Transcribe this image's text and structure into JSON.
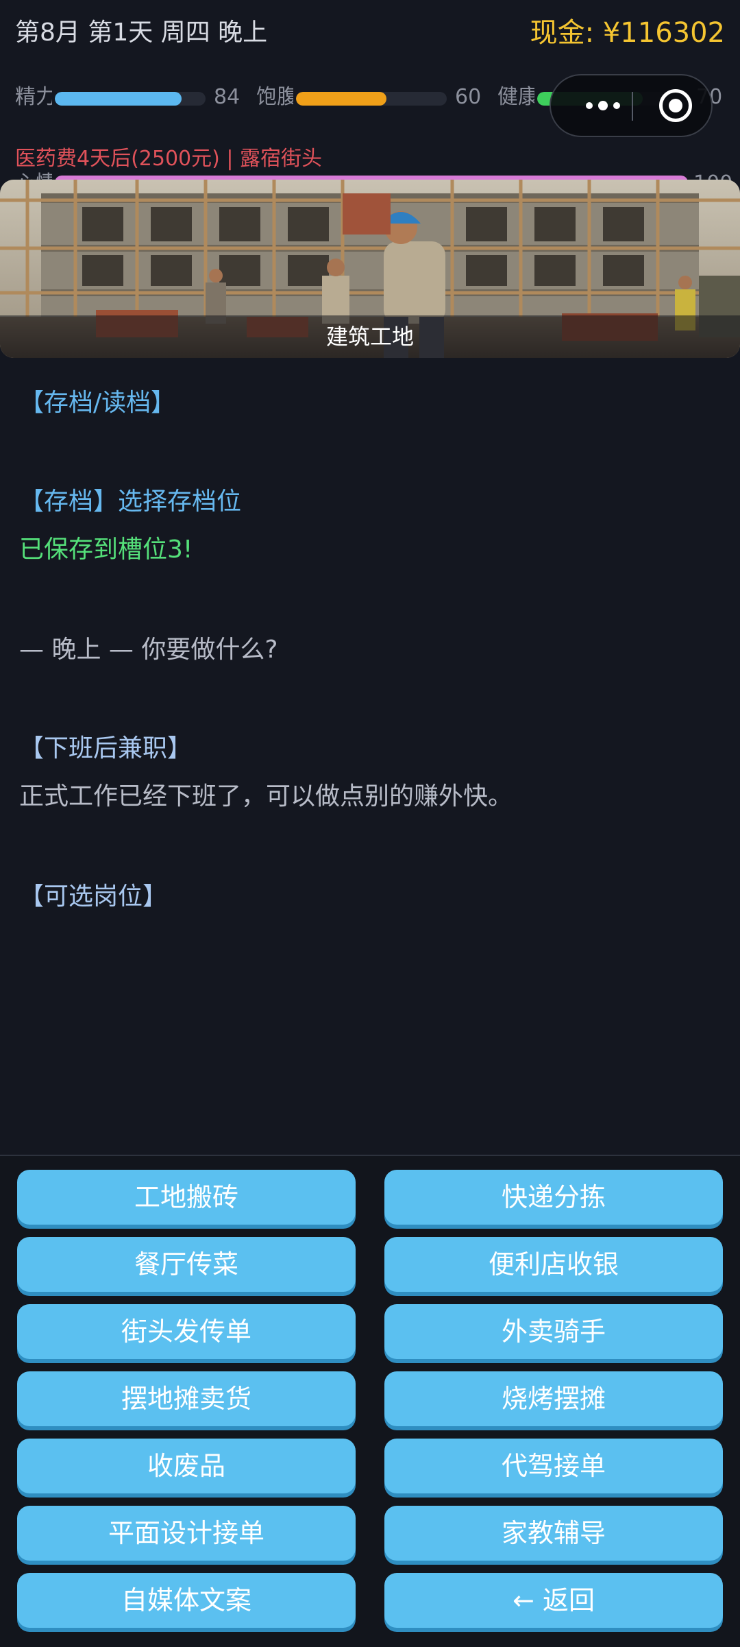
{
  "header": {
    "date": "第8月 第1天 周四 晚上",
    "cash": "现金: ¥116302"
  },
  "stats": [
    {
      "label": "精力",
      "value": "84",
      "percent": 84,
      "color": "#5cb8f0"
    },
    {
      "label": "饱腹",
      "value": "60",
      "percent": 60,
      "color": "#f0a019"
    },
    {
      "label": "健康",
      "value": "70",
      "percent": 70,
      "color": "#3ecf5c"
    },
    {
      "label": "心情",
      "value": "100",
      "percent": 100,
      "color": "#d77bd6"
    }
  ],
  "warning": "医药费4天后(2500元) | 露宿街头",
  "scene": {
    "caption": "建筑工地"
  },
  "log": [
    {
      "text": "【存档/读档】",
      "color": "blue"
    },
    {
      "text": "【存档】选择存档位",
      "color": "blue"
    },
    {
      "text": "已保存到槽位3!",
      "color": "green"
    },
    {
      "text": "— 晚上 —  你要做什么?",
      "color": "gray"
    },
    {
      "text": "【下班后兼职】",
      "color": "lightblue"
    },
    {
      "text": "正式工作已经下班了，可以做点别的赚外快。",
      "color": "gray"
    },
    {
      "text": "【可选岗位】",
      "color": "lightblue"
    }
  ],
  "actions": [
    "工地搬砖",
    "快递分拣",
    "餐厅传菜",
    "便利店收银",
    "街头发传单",
    "外卖骑手",
    "摆地摊卖货",
    "烧烤摆摊",
    "收废品",
    "代驾接单",
    "平面设计接单",
    "家教辅导",
    "自媒体文案",
    "← 返回"
  ],
  "icons": {
    "more": "more-dots-icon",
    "close": "target-close-icon"
  }
}
